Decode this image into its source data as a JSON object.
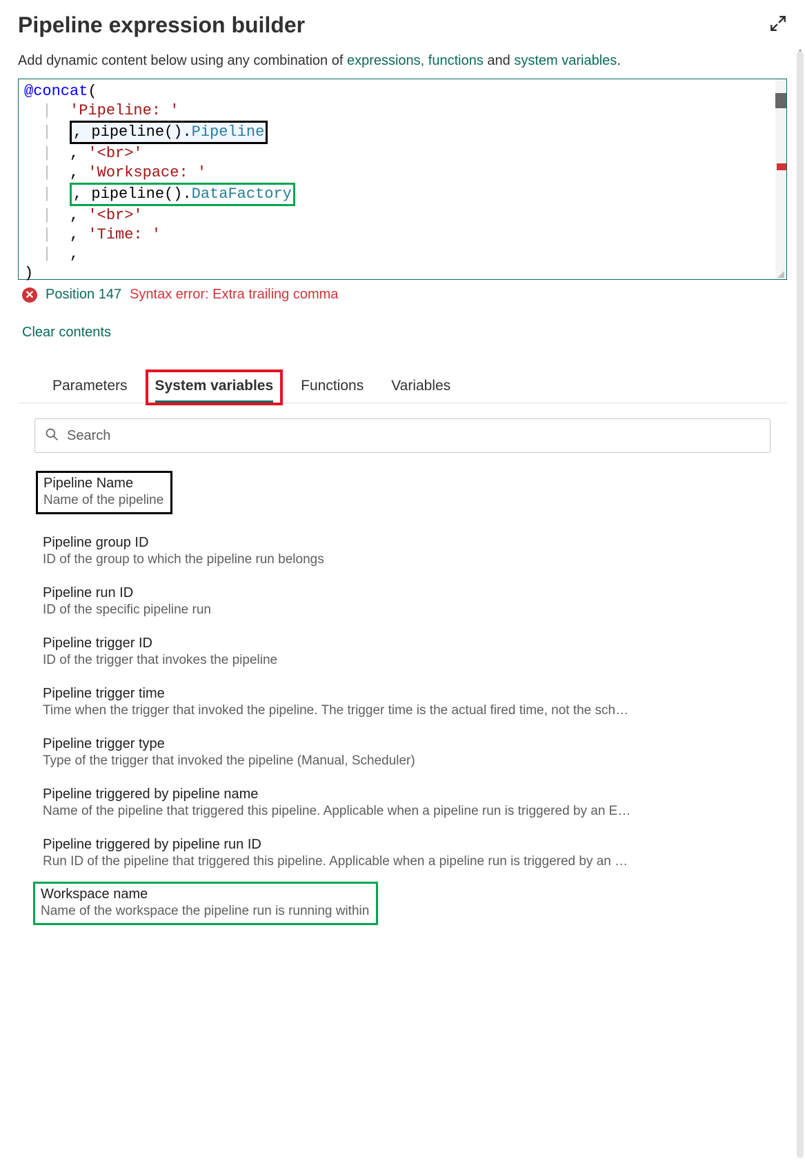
{
  "header": {
    "title": "Pipeline expression builder"
  },
  "intro": {
    "prefix": "Add dynamic content below using any combination of ",
    "link1": "expressions,",
    "link2": "functions",
    "and": " and ",
    "link3": "system variables",
    "suffix": "."
  },
  "code": {
    "line1_kw": "@concat",
    "line1_paren": "(",
    "line2_str": "'Pipeline: '",
    "line3_comma": ", ",
    "line3_fn": "pipeline().",
    "line3_prop": "Pipeline",
    "line4_comma": ", ",
    "line4_str": "'<br>'",
    "line5_comma": ", ",
    "line5_str": "'Workspace: '",
    "line6_comma": ", ",
    "line6_fn": "pipeline().",
    "line6_prop": "DataFactory",
    "line7_comma": ", ",
    "line7_str": "'<br>'",
    "line8_comma": ", ",
    "line8_str": "'Time: '",
    "line9_comma": ",",
    "line10_paren": ")"
  },
  "error": {
    "position": "Position 147",
    "message": "Syntax error: Extra trailing comma"
  },
  "clear_contents": "Clear contents",
  "tabs": {
    "parameters": "Parameters",
    "system_variables": "System variables",
    "functions": "Functions",
    "variables": "Variables"
  },
  "search": {
    "placeholder": "Search"
  },
  "items": [
    {
      "title": "Pipeline Name",
      "desc": "Name of the pipeline"
    },
    {
      "title": "Pipeline group ID",
      "desc": "ID of the group to which the pipeline run belongs"
    },
    {
      "title": "Pipeline run ID",
      "desc": "ID of the specific pipeline run"
    },
    {
      "title": "Pipeline trigger ID",
      "desc": "ID of the trigger that invokes the pipeline"
    },
    {
      "title": "Pipeline trigger time",
      "desc": "Time when the trigger that invoked the pipeline. The trigger time is the actual fired time, not the sch…"
    },
    {
      "title": "Pipeline trigger type",
      "desc": "Type of the trigger that invoked the pipeline (Manual, Scheduler)"
    },
    {
      "title": "Pipeline triggered by pipeline name",
      "desc": "Name of the pipeline that triggered this pipeline. Applicable when a pipeline run is triggered by an E…"
    },
    {
      "title": "Pipeline triggered by pipeline run ID",
      "desc": "Run ID of the pipeline that triggered this pipeline. Applicable when a pipeline run is triggered by an …"
    },
    {
      "title": "Workspace name",
      "desc": "Name of the workspace the pipeline run is running within"
    }
  ]
}
